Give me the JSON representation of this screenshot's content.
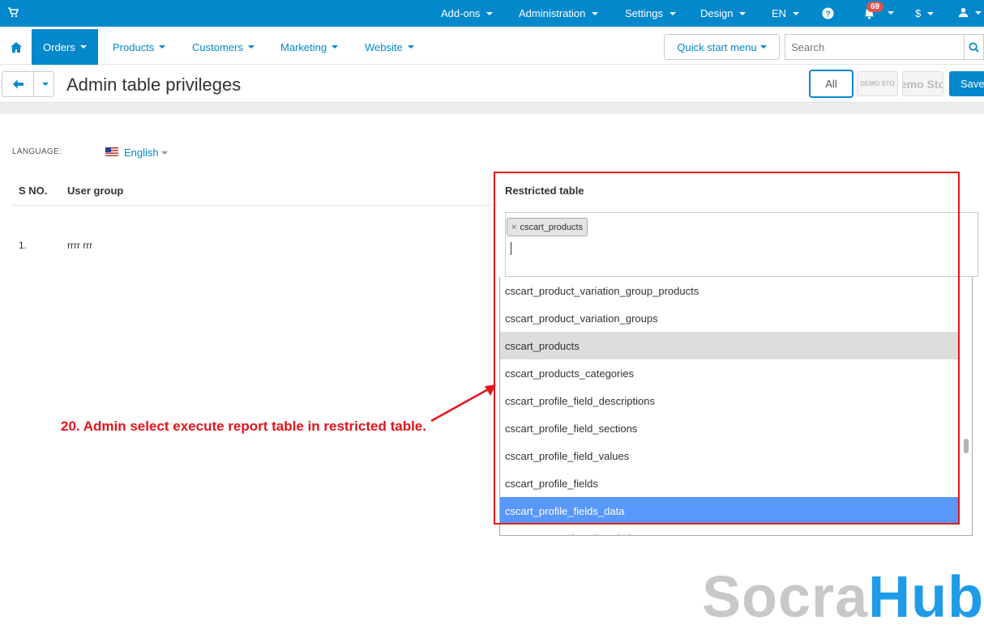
{
  "topbar": {
    "cart_icon": "cart-icon",
    "menu": [
      "Add-ons",
      "Administration",
      "Settings",
      "Design",
      "EN"
    ],
    "help_icon": "question-circle-icon",
    "bell_icon": "bell-icon",
    "notifications_count": "69",
    "currency": "$",
    "user_icon": "user-icon"
  },
  "navbar": {
    "home_icon": "home-icon",
    "tabs": [
      "Orders",
      "Products",
      "Customers",
      "Marketing",
      "Website"
    ],
    "quick_start": "Quick start menu",
    "search_placeholder": "Search"
  },
  "titlebar": {
    "title": "Admin table privileges",
    "all_label": "All",
    "store1": "DEMO STO",
    "store2": "emo Sto",
    "save_label": "Save"
  },
  "language": {
    "label": "LANGUAGE:",
    "value": "English"
  },
  "table": {
    "headers": [
      "S NO.",
      "User group",
      "Restricted table"
    ],
    "rows": [
      {
        "sno": "1.",
        "group": "rrrr rrr"
      }
    ]
  },
  "restricted": {
    "selected_tags": [
      "cscart_products"
    ],
    "options": [
      "cscart_product_variation_group_products",
      "cscart_product_variation_groups",
      "cscart_products",
      "cscart_products_categories",
      "cscart_profile_field_descriptions",
      "cscart_profile_field_sections",
      "cscart_profile_field_values",
      "cscart_profile_fields",
      "cscart_profile_fields_data",
      "cscart_promotion_descriptions"
    ]
  },
  "annotation": "20. Admin select execute report table in restricted table.",
  "watermark": {
    "part1": "Socra",
    "part2": "Hub"
  },
  "colors": {
    "primary": "#0388cc",
    "annotation": "#e3141c",
    "highlight": "#5897fb",
    "watermark_gray": "#c8c8c8",
    "watermark_blue": "#1e9be9"
  }
}
